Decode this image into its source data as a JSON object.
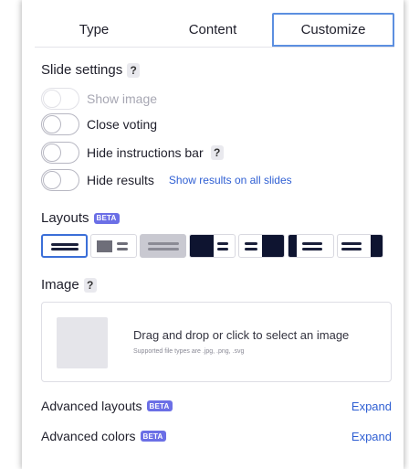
{
  "tabs": [
    {
      "label": "Type",
      "active": false
    },
    {
      "label": "Content",
      "active": false
    },
    {
      "label": "Customize",
      "active": true
    }
  ],
  "slide_settings": {
    "title": "Slide settings",
    "help": "?",
    "toggles": [
      {
        "label": "Show image",
        "on": false,
        "disabled": true
      },
      {
        "label": "Close voting",
        "on": false,
        "disabled": false
      },
      {
        "label": "Hide instructions bar",
        "on": false,
        "disabled": false,
        "help": "?"
      },
      {
        "label": "Hide results",
        "on": false,
        "disabled": false,
        "link": "Show results on all slides"
      }
    ]
  },
  "layouts": {
    "title": "Layouts",
    "badge": "BETA",
    "selected_index": 0,
    "options": [
      "layout-text-centered",
      "layout-image-left",
      "layout-image-background",
      "layout-image-left-dark",
      "layout-image-right-dark",
      "layout-split-left-dark",
      "layout-split-right-dark"
    ]
  },
  "image": {
    "title": "Image",
    "help": "?",
    "drop_title": "Drag and drop or click to select an image",
    "drop_subtitle": "Supported file types are .jpg, .png, .svg"
  },
  "advanced": [
    {
      "label": "Advanced layouts",
      "badge": "BETA",
      "action": "Expand"
    },
    {
      "label": "Advanced colors",
      "badge": "BETA",
      "action": "Expand"
    }
  ],
  "colors": {
    "accent": "#3b6fd8",
    "link": "#2f5fd3",
    "beta": "#6b6fe6",
    "dark_block": "#0e1430"
  }
}
